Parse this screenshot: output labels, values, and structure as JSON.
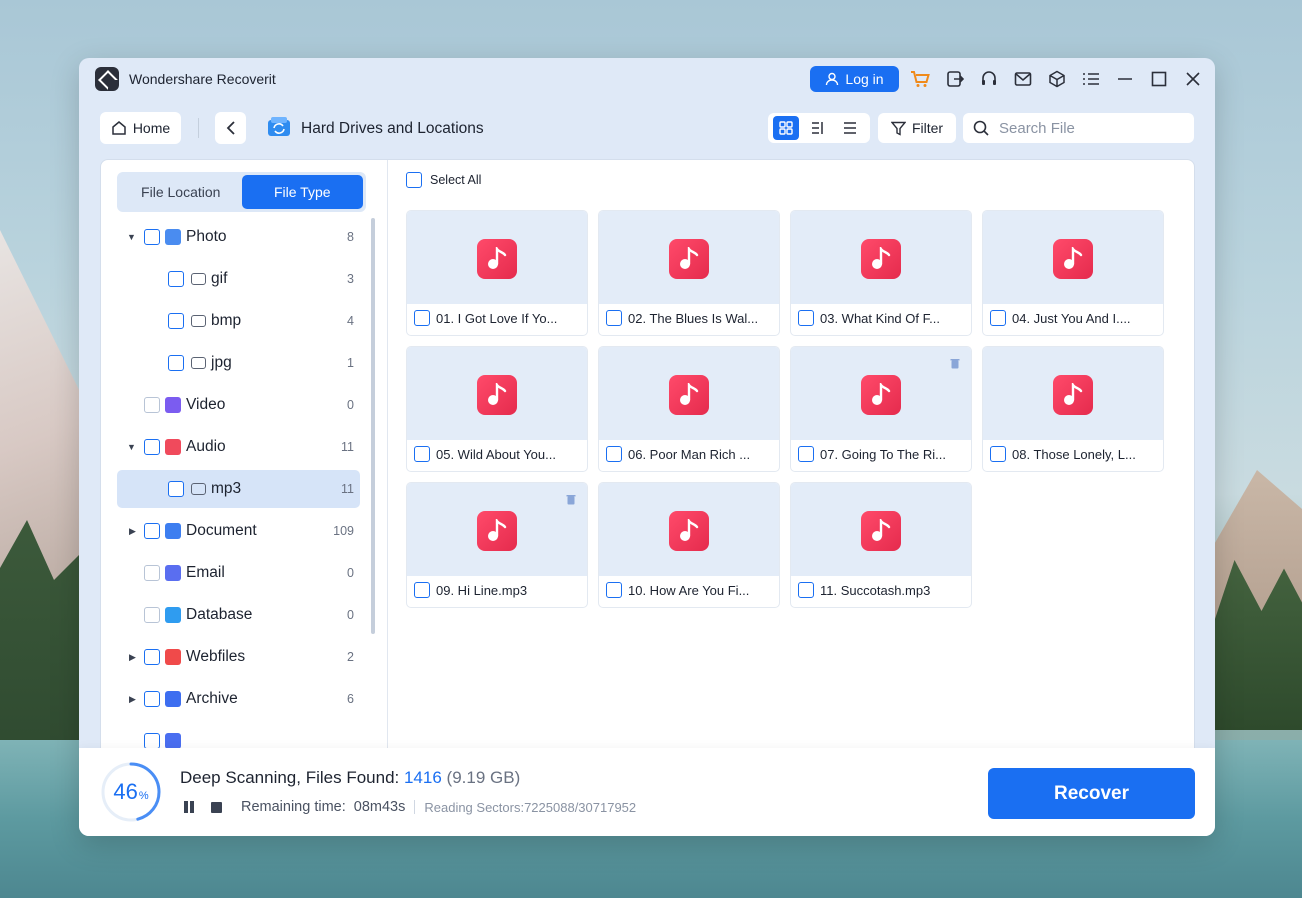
{
  "app": {
    "title": "Wondershare Recoverit"
  },
  "titlebar": {
    "login_label": "Log in"
  },
  "toolbar": {
    "home_label": "Home",
    "location_title": "Hard Drives and Locations",
    "filter_label": "Filter",
    "search_placeholder": "Search File"
  },
  "sidebar": {
    "tabs": [
      {
        "label": "File Location",
        "active": false
      },
      {
        "label": "File Type",
        "active": true
      }
    ],
    "tree": [
      {
        "label": "Photo",
        "count": "8",
        "expanded": true,
        "icon": "photo-icon",
        "color": "#4a8cf0"
      },
      {
        "label": "gif",
        "count": "3",
        "icon": "folder-icon"
      },
      {
        "label": "bmp",
        "count": "4",
        "icon": "folder-icon"
      },
      {
        "label": "jpg",
        "count": "1",
        "icon": "folder-icon"
      },
      {
        "label": "Video",
        "count": "0",
        "icon": "video-icon",
        "color": "#7b5cf0"
      },
      {
        "label": "Audio",
        "count": "11",
        "expanded": true,
        "icon": "audio-icon",
        "color": "#f04a5c"
      },
      {
        "label": "mp3",
        "count": "11",
        "icon": "folder-icon",
        "selected": true
      },
      {
        "label": "Document",
        "count": "109",
        "expanded": false,
        "icon": "document-icon",
        "color": "#3d7ef0"
      },
      {
        "label": "Email",
        "count": "0",
        "icon": "email-icon",
        "color": "#5a6ef0"
      },
      {
        "label": "Database",
        "count": "0",
        "icon": "database-icon",
        "color": "#2f9cf0"
      },
      {
        "label": "Webfiles",
        "count": "2",
        "expanded": false,
        "icon": "webfiles-icon",
        "color": "#f04a4a"
      },
      {
        "label": "Archive",
        "count": "6",
        "expanded": false,
        "icon": "archive-icon",
        "color": "#3d6ef0"
      }
    ]
  },
  "content": {
    "select_all_label": "Select All",
    "files": [
      {
        "name": "01. I Got Love If Yo...",
        "deleted": false
      },
      {
        "name": "02. The Blues Is Wal...",
        "deleted": false
      },
      {
        "name": "03. What Kind Of F...",
        "deleted": false
      },
      {
        "name": "04. Just You And I....",
        "deleted": false
      },
      {
        "name": "05. Wild About You...",
        "deleted": false
      },
      {
        "name": "06. Poor Man Rich ...",
        "deleted": false
      },
      {
        "name": "07. Going To The Ri...",
        "deleted": true
      },
      {
        "name": "08. Those Lonely, L...",
        "deleted": false
      },
      {
        "name": "09. Hi Line.mp3",
        "deleted": true
      },
      {
        "name": "10. How Are You Fi...",
        "deleted": false
      },
      {
        "name": "11. Succotash.mp3",
        "deleted": false
      }
    ]
  },
  "status": {
    "progress_value": "46",
    "progress_unit": "%",
    "progress_fraction": 0.46,
    "scan_label": "Deep Scanning, Files Found: ",
    "files_found": "1416",
    "size": "(9.19 GB)",
    "remaining_label": "Remaining time:",
    "remaining_value": "08m43s",
    "sectors": "Reading Sectors:7225088/30717952"
  },
  "actions": {
    "recover_label": "Recover"
  },
  "colors": {
    "accent": "#1a6ff2",
    "music_icon": "#f04a5c"
  }
}
